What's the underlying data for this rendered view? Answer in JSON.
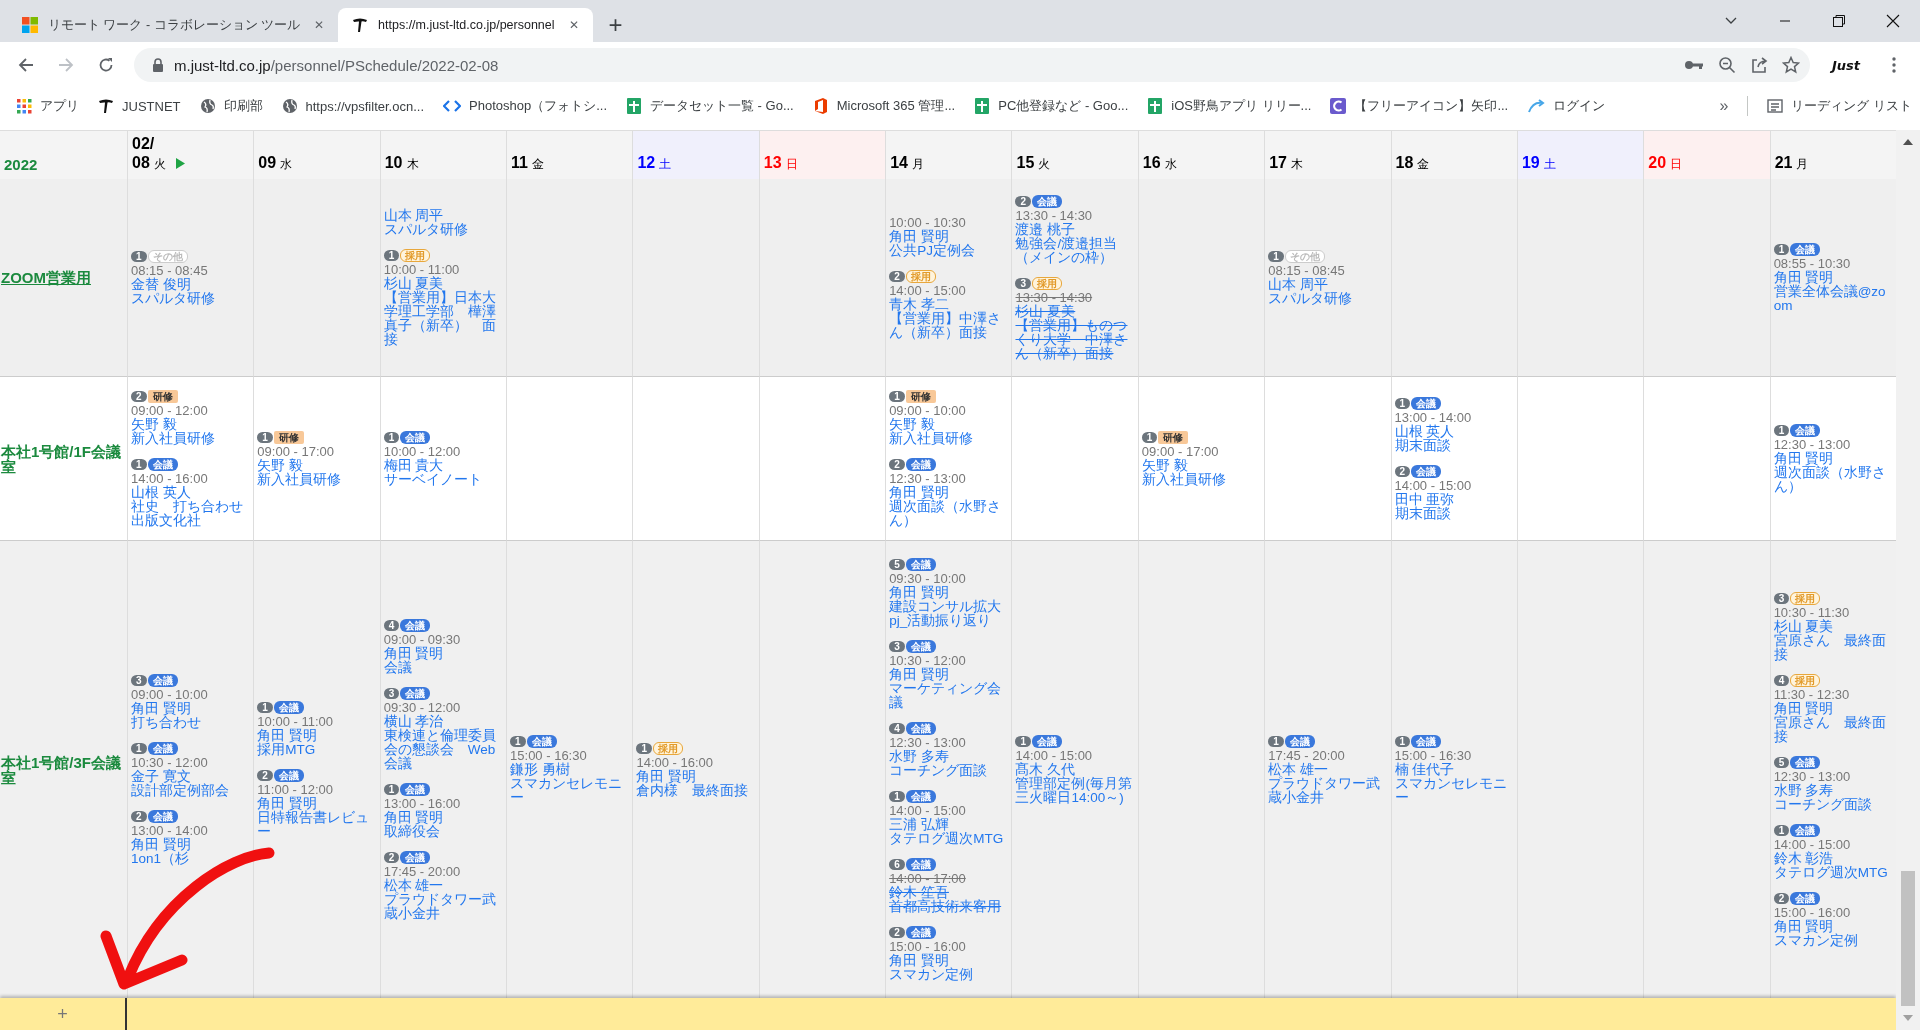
{
  "browser": {
    "tabs": [
      {
        "kind": "windows",
        "title": "リモート ワーク - コラボレーション ツール",
        "close": "✕",
        "selected": false
      },
      {
        "kind": "just",
        "title": "https://m.just-ltd.co.jp/personnel",
        "close": "✕",
        "selected": true
      }
    ],
    "new_tab": "+",
    "address": {
      "host": "m.just-ltd.co.jp",
      "path": "/personnel/PSchedule/2022-02-08"
    },
    "profile": "Just",
    "bookmarks": [
      {
        "kind": "apps",
        "label": "アプリ"
      },
      {
        "kind": "just",
        "label": "JUSTNET"
      },
      {
        "kind": "globe",
        "label": "印刷部"
      },
      {
        "kind": "globe",
        "label": "https://vpsfilter.ocn..."
      },
      {
        "kind": "code",
        "label": "Photoshop（フォトシ..."
      },
      {
        "kind": "sheet",
        "label": "データセット一覧 - Go..."
      },
      {
        "kind": "office",
        "label": "Microsoft 365 管理..."
      },
      {
        "kind": "sheet",
        "label": "PC他登録など - Goo..."
      },
      {
        "kind": "sheet",
        "label": "iOS野鳥アプリ リリー..."
      },
      {
        "kind": "letter",
        "label": "【フリーアイコン】矢印..."
      },
      {
        "kind": "arc",
        "label": "ログイン"
      }
    ],
    "more": "»",
    "reading_list": "リーディング リスト"
  },
  "calendar": {
    "year": "2022",
    "month": "02/",
    "days": [
      {
        "day": "08",
        "weekday": "火",
        "kind": "weekday",
        "today": true
      },
      {
        "day": "09",
        "weekday": "水",
        "kind": "weekday",
        "today": false
      },
      {
        "day": "10",
        "weekday": "木",
        "kind": "weekday",
        "today": false
      },
      {
        "day": "11",
        "weekday": "金",
        "kind": "weekday",
        "today": false
      },
      {
        "day": "12",
        "weekday": "土",
        "kind": "saturday",
        "today": false
      },
      {
        "day": "13",
        "weekday": "日",
        "kind": "sunday",
        "today": false
      },
      {
        "day": "14",
        "weekday": "月",
        "kind": "weekday",
        "today": false
      },
      {
        "day": "15",
        "weekday": "火",
        "kind": "weekday",
        "today": false
      },
      {
        "day": "16",
        "weekday": "水",
        "kind": "weekday",
        "today": false
      },
      {
        "day": "17",
        "weekday": "木",
        "kind": "weekday",
        "today": false
      },
      {
        "day": "18",
        "weekday": "金",
        "kind": "weekday",
        "today": false
      },
      {
        "day": "19",
        "weekday": "土",
        "kind": "saturday",
        "today": false
      },
      {
        "day": "20",
        "weekday": "日",
        "kind": "sunday",
        "today": false
      },
      {
        "day": "21",
        "weekday": "月",
        "kind": "weekday",
        "today": false
      }
    ],
    "rows": [
      {
        "name": "ZOOM営業用",
        "link": true,
        "cells": [
          [
            {
              "number": "1",
              "tag": {
                "kind": "other",
                "label": "その他"
              },
              "time": "08:15 - 08:45",
              "name": "金替 俊明",
              "title": "スパルタ研修",
              "cancelled": false
            }
          ],
          [],
          [
            {
              "name": "山本 周平",
              "title": "スパルタ研修",
              "cancelled": false
            },
            {
              "number": "1",
              "tag": {
                "kind": "hiring",
                "label": "採用"
              },
              "time": "10:00 - 11:00",
              "name": "杉山 夏美",
              "title": "【営業用】日本大学理工学部　樺澤真子（新卒）　面接",
              "cancelled": false
            }
          ],
          [],
          [],
          [],
          [
            {
              "time": "10:00 - 10:30",
              "name": "角田 賢明",
              "title": "公共PJ定例会",
              "cancelled": false
            },
            {
              "number": "2",
              "tag": {
                "kind": "hiring",
                "label": "採用"
              },
              "time": "14:00 - 15:00",
              "name": "青木 孝二",
              "title": "【営業用】中澤さん（新卒）面接",
              "cancelled": false
            }
          ],
          [
            {
              "number": "2",
              "tag": {
                "kind": "meeting",
                "label": "会議"
              },
              "time": "13:30 - 14:30",
              "name": "渡邉 桃子",
              "title": "勉強会/渡邉担当（メインの枠）",
              "cancelled": false
            },
            {
              "number": "3",
              "tag": {
                "kind": "hiring",
                "label": "採用"
              },
              "time": "13:30 - 14:30",
              "name": "杉山 夏美",
              "title": "【営業用】ものつくり大学　中澤さん（新卒）面接",
              "cancelled": true
            }
          ],
          [],
          [
            {
              "number": "1",
              "tag": {
                "kind": "other",
                "label": "その他"
              },
              "time": "08:15 - 08:45",
              "name": "山本 周平",
              "title": "スパルタ研修",
              "cancelled": false
            }
          ],
          [],
          [],
          [],
          [
            {
              "number": "1",
              "tag": {
                "kind": "meeting",
                "label": "会議"
              },
              "time": "08:55 - 10:30",
              "name": "角田 賢明",
              "title": "営業全体会議@zoom",
              "cancelled": false
            }
          ]
        ]
      },
      {
        "name": "本社1号館/1F会議室",
        "link": false,
        "cells": [
          [
            {
              "number": "2",
              "tag": {
                "kind": "training",
                "label": "研修"
              },
              "time": "09:00 - 12:00",
              "name": "矢野 毅",
              "title": "新入社員研修",
              "cancelled": false
            },
            {
              "number": "1",
              "tag": {
                "kind": "meeting",
                "label": "会議"
              },
              "time": "14:00 - 16:00",
              "name": "山根 英人",
              "title": "社史　打ち合わせ出版文化社",
              "cancelled": false
            }
          ],
          [
            {
              "number": "1",
              "tag": {
                "kind": "training",
                "label": "研修"
              },
              "time": "09:00 - 17:00",
              "name": "矢野 毅",
              "title": "新入社員研修",
              "cancelled": false
            }
          ],
          [
            {
              "number": "1",
              "tag": {
                "kind": "meeting",
                "label": "会議"
              },
              "time": "10:00 - 12:00",
              "name": "梅田 貴大",
              "title": "サーベイノート",
              "cancelled": false
            }
          ],
          [],
          [],
          [],
          [
            {
              "number": "1",
              "tag": {
                "kind": "training",
                "label": "研修"
              },
              "time": "09:00 - 10:00",
              "name": "矢野 毅",
              "title": "新入社員研修",
              "cancelled": false
            },
            {
              "number": "2",
              "tag": {
                "kind": "meeting",
                "label": "会議"
              },
              "time": "12:30 - 13:00",
              "name": "角田 賢明",
              "title": "週次面談（水野さん）",
              "cancelled": false
            }
          ],
          [],
          [
            {
              "number": "1",
              "tag": {
                "kind": "training",
                "label": "研修"
              },
              "time": "09:00 - 17:00",
              "name": "矢野 毅",
              "title": "新入社員研修",
              "cancelled": false
            }
          ],
          [],
          [
            {
              "number": "1",
              "tag": {
                "kind": "meeting",
                "label": "会議"
              },
              "time": "13:00 - 14:00",
              "name": "山根 英人",
              "title": "期末面談",
              "cancelled": false
            },
            {
              "number": "2",
              "tag": {
                "kind": "meeting",
                "label": "会議"
              },
              "time": "14:00 - 15:00",
              "name": "田中 亜弥",
              "title": "期末面談",
              "cancelled": false
            }
          ],
          [],
          [],
          [
            {
              "number": "1",
              "tag": {
                "kind": "meeting",
                "label": "会議"
              },
              "time": "12:30 - 13:00",
              "name": "角田 賢明",
              "title": "週次面談（水野さん）",
              "cancelled": false
            }
          ]
        ]
      },
      {
        "name": "本社1号館/3F会議室",
        "link": false,
        "cells": [
          [
            {
              "number": "3",
              "tag": {
                "kind": "meeting",
                "label": "会議"
              },
              "time": "09:00 - 10:00",
              "name": "角田 賢明",
              "title": "打ち合わせ",
              "cancelled": false
            },
            {
              "number": "1",
              "tag": {
                "kind": "meeting",
                "label": "会議"
              },
              "time": "10:30 - 12:00",
              "name": "金子 寛文",
              "title": "設計部定例部会",
              "cancelled": false
            },
            {
              "number": "2",
              "tag": {
                "kind": "meeting",
                "label": "会議"
              },
              "time": "13:00 - 14:00",
              "name": "角田 賢明",
              "title": "1on1（杉",
              "cancelled": false
            }
          ],
          [
            {
              "number": "1",
              "tag": {
                "kind": "meeting",
                "label": "会議"
              },
              "time": "10:00 - 11:00",
              "name": "角田 賢明",
              "title": "採用MTG",
              "cancelled": false
            },
            {
              "number": "2",
              "tag": {
                "kind": "meeting",
                "label": "会議"
              },
              "time": "11:00 - 12:00",
              "name": "角田 賢明",
              "title": "日特報告書レビュー",
              "cancelled": false
            }
          ],
          [
            {
              "number": "4",
              "tag": {
                "kind": "meeting",
                "label": "会議"
              },
              "time": "09:00 - 09:30",
              "name": "角田 賢明",
              "title": "会議",
              "cancelled": false
            },
            {
              "number": "3",
              "tag": {
                "kind": "meeting",
                "label": "会議"
              },
              "time": "09:30 - 12:00",
              "name": "横山 孝治",
              "title": "東検連と倫理委員会の懇談会　Web会議",
              "cancelled": false
            },
            {
              "number": "1",
              "tag": {
                "kind": "meeting",
                "label": "会議"
              },
              "time": "13:00 - 16:00",
              "name": "角田 賢明",
              "title": "取締役会",
              "cancelled": false
            },
            {
              "number": "2",
              "tag": {
                "kind": "meeting",
                "label": "会議"
              },
              "time": "17:45 - 20:00",
              "name": "松本 雄一",
              "title": "プラウドタワー武蔵小金井",
              "cancelled": false
            }
          ],
          [
            {
              "number": "1",
              "tag": {
                "kind": "meeting",
                "label": "会議"
              },
              "time": "15:00 - 16:30",
              "name": "鎌形 勇樹",
              "title": "スマカンセレモニー",
              "cancelled": false
            }
          ],
          [
            {
              "number": "1",
              "tag": {
                "kind": "hiring",
                "label": "採用"
              },
              "time": "14:00 - 16:00",
              "name": "角田 賢明",
              "title": "倉内様　最終面接",
              "cancelled": false
            }
          ],
          [],
          [
            {
              "number": "5",
              "tag": {
                "kind": "meeting",
                "label": "会議"
              },
              "time": "09:30 - 10:00",
              "name": "角田 賢明",
              "title": "建設コンサル拡大pj_活動振り返り",
              "cancelled": false
            },
            {
              "number": "3",
              "tag": {
                "kind": "meeting",
                "label": "会議"
              },
              "time": "10:30 - 12:00",
              "name": "角田 賢明",
              "title": "マーケティング会議",
              "cancelled": false
            },
            {
              "number": "4",
              "tag": {
                "kind": "meeting",
                "label": "会議"
              },
              "time": "12:30 - 13:00",
              "name": "水野 多寿",
              "title": "コーチング面談",
              "cancelled": false
            },
            {
              "number": "1",
              "tag": {
                "kind": "meeting",
                "label": "会議"
              },
              "time": "14:00 - 15:00",
              "name": "三浦 弘輝",
              "title": "タテログ週次MTG",
              "cancelled": false
            },
            {
              "number": "6",
              "tag": {
                "kind": "meeting",
                "label": "会議"
              },
              "time": "14:00 - 17:00",
              "name": "鈴木 笙吾",
              "title": "首都高技術来客用",
              "cancelled": true
            },
            {
              "number": "2",
              "tag": {
                "kind": "meeting",
                "label": "会議"
              },
              "time": "15:00 - 16:00",
              "name": "角田 賢明",
              "title": "スマカン定例",
              "cancelled": false
            }
          ],
          [
            {
              "number": "1",
              "tag": {
                "kind": "meeting",
                "label": "会議"
              },
              "time": "14:00 - 15:00",
              "name": "髙木 久代",
              "title": "管理部定例(毎月第三火曜日14:00～)",
              "cancelled": false
            }
          ],
          [],
          [
            {
              "number": "1",
              "tag": {
                "kind": "meeting",
                "label": "会議"
              },
              "time": "17:45 - 20:00",
              "name": "松本 雄一",
              "title": "プラウドタワー武蔵小金井",
              "cancelled": false
            }
          ],
          [
            {
              "number": "1",
              "tag": {
                "kind": "meeting",
                "label": "会議"
              },
              "time": "15:00 - 16:30",
              "name": "楠 佳代子",
              "title": "スマカンセレモニー",
              "cancelled": false
            }
          ],
          [],
          [],
          [
            {
              "number": "3",
              "tag": {
                "kind": "hiring",
                "label": "採用"
              },
              "time": "10:30 - 11:30",
              "name": "杉山 夏美",
              "title": "宮原さん　最終面接",
              "cancelled": false
            },
            {
              "number": "4",
              "tag": {
                "kind": "hiring",
                "label": "採用"
              },
              "time": "11:30 - 12:30",
              "name": "角田 賢明",
              "title": "宮原さん　最終面接",
              "cancelled": false
            },
            {
              "number": "5",
              "tag": {
                "kind": "meeting",
                "label": "会議"
              },
              "time": "12:30 - 13:00",
              "name": "水野 多寿",
              "title": "コーチング面談",
              "cancelled": false
            },
            {
              "number": "1",
              "tag": {
                "kind": "meeting",
                "label": "会議"
              },
              "time": "14:00 - 15:00",
              "name": "鈴木 彰浩",
              "title": "タテログ週次MTG",
              "cancelled": false
            },
            {
              "number": "2",
              "tag": {
                "kind": "meeting",
                "label": "会議"
              },
              "time": "15:00 - 16:00",
              "name": "角田 賢明",
              "title": "スマカン定例",
              "cancelled": false
            }
          ]
        ]
      }
    ],
    "add_button": "+"
  }
}
